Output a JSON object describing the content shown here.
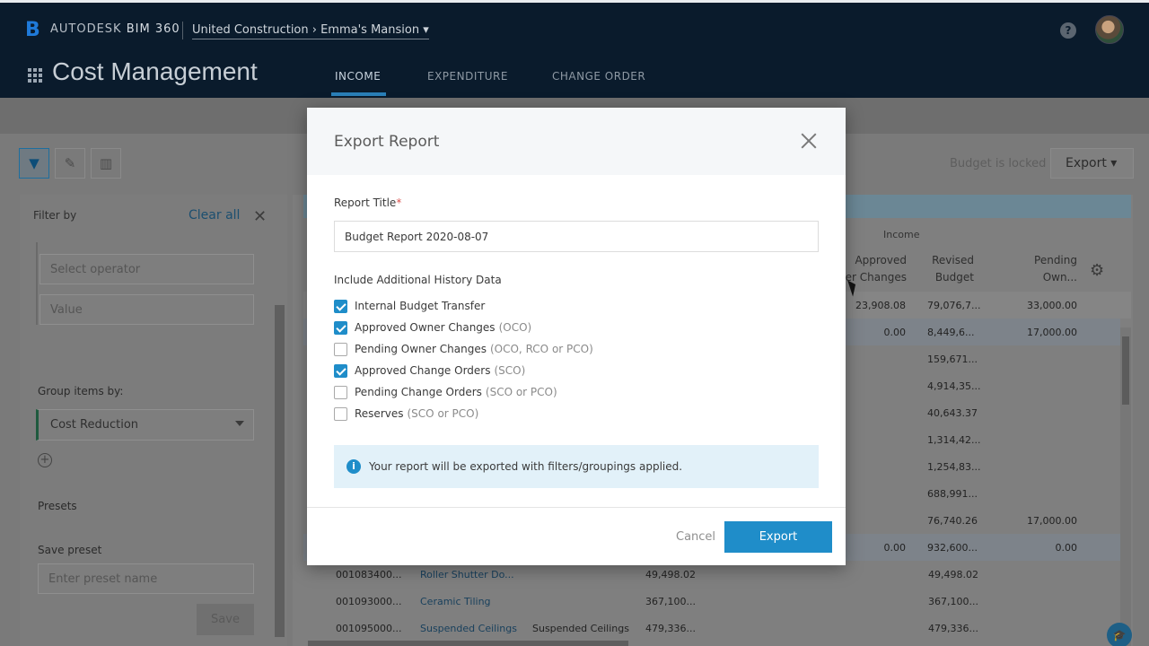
{
  "header": {
    "brand_prefix": "AUTODESK",
    "brand_product": "BIM 360",
    "breadcrumb": "United Construction › Emma's Mansion ▾",
    "help_label": "?",
    "app_title": "Cost Management",
    "tabs": [
      {
        "label": "INCOME",
        "active": true
      },
      {
        "label": "EXPENDITURE",
        "active": false
      },
      {
        "label": "CHANGE ORDER",
        "active": false
      }
    ]
  },
  "toolbar": {
    "budget_status": "Budget is locked",
    "export_label": "Export ▾"
  },
  "filter_panel": {
    "title": "Filter by",
    "clear_all": "Clear all",
    "operator_placeholder": "Select operator",
    "value_placeholder": "Value",
    "group_label": "Group items by:",
    "group_value": "Cost Reduction",
    "presets_label": "Presets",
    "save_preset_label": "Save preset",
    "preset_placeholder": "Enter preset name",
    "save_button": "Save"
  },
  "grid": {
    "group_header": "Income",
    "columns": [
      "Approved\ner Changes",
      "Revised\nBudget",
      "Pending\nOwn..."
    ],
    "rows": [
      {
        "approved": "23,908.08",
        "revised": "79,076,7...",
        "pending": "33,000.00"
      },
      {
        "approved": "0.00",
        "revised": "8,449,6...",
        "pending": "17,000.00"
      },
      {
        "approved": "",
        "revised": "159,671...",
        "pending": ""
      },
      {
        "approved": "",
        "revised": "4,914,35...",
        "pending": ""
      },
      {
        "approved": "",
        "revised": "40,643.37",
        "pending": ""
      },
      {
        "approved": "",
        "revised": "1,314,42...",
        "pending": ""
      },
      {
        "approved": "",
        "revised": "1,254,83...",
        "pending": ""
      },
      {
        "approved": "",
        "revised": "688,991...",
        "pending": ""
      },
      {
        "approved": "",
        "revised": "76,740.26",
        "pending": "17,000.00"
      },
      {
        "approved": "0.00",
        "revised": "932,600...",
        "pending": "0.00"
      }
    ],
    "detail_rows": [
      {
        "code": "001083400...",
        "name": "Roller Shutter Do...",
        "group": "",
        "budget": "49,498.02",
        "revised": "49,498.02"
      },
      {
        "code": "001093000...",
        "name": "Ceramic Tiling",
        "group": "",
        "budget": "367,100...",
        "revised": "367,100..."
      },
      {
        "code": "001095000...",
        "name": "Suspended Ceilings",
        "group": "Suspended Ceilings",
        "budget": "479,336...",
        "revised": "479,336..."
      }
    ]
  },
  "modal": {
    "title": "Export Report",
    "report_title_label": "Report Title",
    "required_mark": "*",
    "report_title_value": "Budget Report 2020-08-07",
    "history_label": "Include Additional History Data",
    "options": [
      {
        "label": "Internal Budget Transfer",
        "hint": "",
        "checked": true
      },
      {
        "label": "Approved Owner Changes",
        "hint": "(OCO)",
        "checked": true
      },
      {
        "label": "Pending Owner Changes",
        "hint": "(OCO, RCO or PCO)",
        "checked": false
      },
      {
        "label": "Approved Change Orders",
        "hint": "(SCO)",
        "checked": true
      },
      {
        "label": "Pending Change Orders",
        "hint": "(SCO or PCO)",
        "checked": false
      },
      {
        "label": "Reserves",
        "hint": "(SCO or PCO)",
        "checked": false
      }
    ],
    "info_icon": "i",
    "info_text": "Your report will be exported with filters/groupings applied.",
    "cancel_label": "Cancel",
    "export_label": "Export"
  }
}
